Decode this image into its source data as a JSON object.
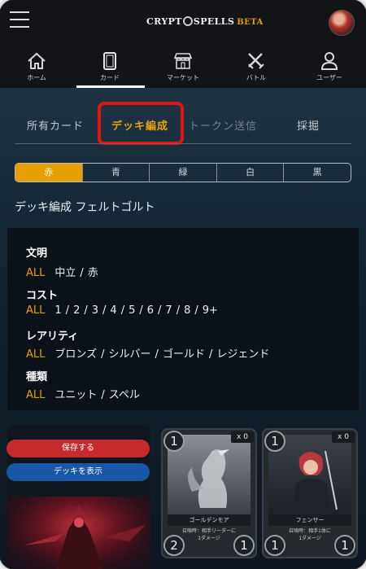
{
  "header": {
    "logo_text": "CRYPTO SPELLS",
    "logo_part1": "CRYPT",
    "logo_part2": "SPELLS",
    "logo_beta": "BETA"
  },
  "nav": {
    "items": [
      {
        "label": "ホーム",
        "icon": "home-icon"
      },
      {
        "label": "カード",
        "icon": "card-icon"
      },
      {
        "label": "マーケット",
        "icon": "market-icon"
      },
      {
        "label": "バトル",
        "icon": "battle-icon"
      },
      {
        "label": "ユーザー",
        "icon": "user-icon"
      }
    ],
    "active_index": 1
  },
  "section_tabs": {
    "owned": "所有カード",
    "deck": "デッキ編成",
    "token": "トークン送信",
    "dig": "採掘"
  },
  "colors": {
    "items": [
      "赤",
      "青",
      "緑",
      "白",
      "黒"
    ],
    "active_index": 0,
    "accent": "#e8a000"
  },
  "deck_title": "デッキ編成 フェルトゴルト",
  "filters": {
    "all_label": "ALL",
    "civ": {
      "title": "文明",
      "options": [
        "中立",
        "赤"
      ]
    },
    "cost": {
      "title": "コスト",
      "options": [
        "1",
        "2",
        "3",
        "4",
        "5",
        "6",
        "7",
        "8",
        "9+"
      ]
    },
    "rarity": {
      "title": "レアリティ",
      "options": [
        "ブロンズ",
        "シルバー",
        "ゴールド",
        "レジェンド"
      ]
    },
    "type": {
      "title": "種類",
      "options": [
        "ユニット",
        "スペル"
      ]
    }
  },
  "buttons": {
    "save": "保存する",
    "show_deck": "デッキを表示"
  },
  "cards": [
    {
      "name": "ゴールデンモア",
      "text_line1": "召喚時：相手リーダーに",
      "text_line2": "1ダメージ",
      "cost": "1",
      "attack": "2",
      "hp": "1",
      "count": "x 0"
    },
    {
      "name": "フェンサー",
      "text_line1": "召喚時：相手1体に",
      "text_line2": "1ダメージ",
      "cost": "1",
      "attack": "1",
      "hp": "1",
      "count": "x 0"
    }
  ]
}
